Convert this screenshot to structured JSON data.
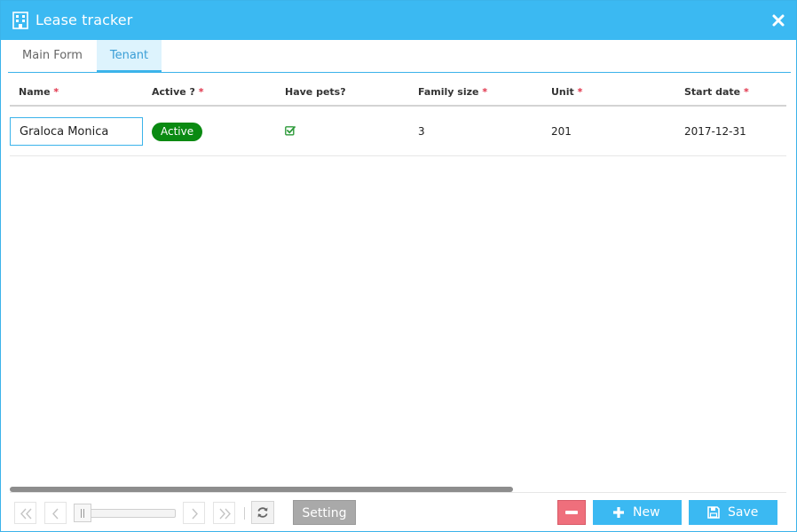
{
  "window": {
    "title": "Lease tracker",
    "title_icon": "building-icon",
    "close_icon": "close-icon",
    "accent_color": "#3bb9f2"
  },
  "tabs": [
    {
      "label": "Main Form",
      "active": false
    },
    {
      "label": "Tenant",
      "active": true
    }
  ],
  "grid": {
    "columns": [
      {
        "label": "Name",
        "required": true
      },
      {
        "label": "Active ?",
        "required": true
      },
      {
        "label": "Have pets?",
        "required": false
      },
      {
        "label": "Family size",
        "required": true
      },
      {
        "label": "Unit",
        "required": true
      },
      {
        "label": "Start date",
        "required": true
      }
    ],
    "required_marker": "*",
    "rows": [
      {
        "name": "Graloca Monica",
        "active": "Active",
        "have_pets": true,
        "family_size": "3",
        "unit": "201",
        "start_date": "2017-12-31"
      }
    ]
  },
  "pager": {
    "first_icon": "double-chevron-left-icon",
    "prev_icon": "chevron-left-icon",
    "next_icon": "chevron-right-icon",
    "last_icon": "double-chevron-right-icon",
    "refresh_icon": "refresh-icon",
    "setting_label": "Setting"
  },
  "actions": {
    "delete_icon": "minus-icon",
    "new_label": "New",
    "new_icon": "plus-icon",
    "save_label": "Save",
    "save_icon": "floppy-disk-icon",
    "delete_color": "#ef6f7c"
  },
  "status_colors": {
    "active_badge": "#0a8a12",
    "required": "#e0334a"
  }
}
